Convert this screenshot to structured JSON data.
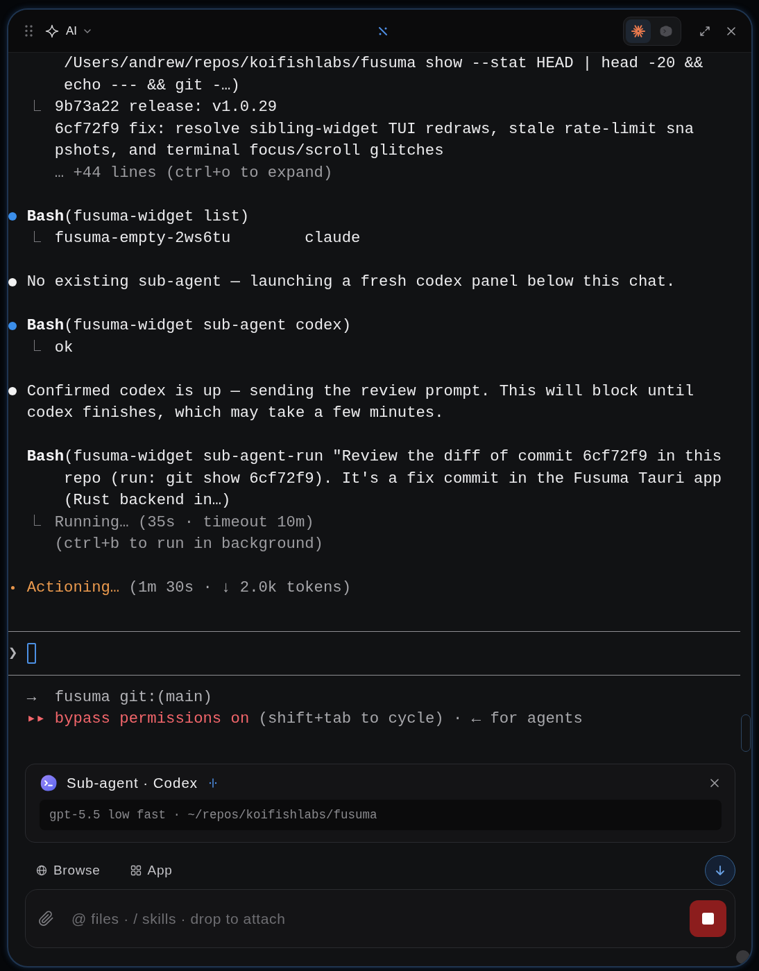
{
  "window": {
    "title": "AI",
    "agent_switch": [
      {
        "kind": "burst",
        "selected": true
      },
      {
        "kind": "blob",
        "selected": false
      }
    ]
  },
  "terminal": {
    "blocks": [
      {
        "kind": "continued",
        "lines": [
          "/Users/andrew/repos/koifishlabs/fusuma show --stat HEAD | head -20 &&",
          "echo --- && git -…)"
        ],
        "output": [
          {
            "text": "9b73a22 release: v1.0.29",
            "muted": false
          },
          {
            "text": "6cf72f9 fix: resolve sibling-widget TUI redraws, stale rate-limit sna",
            "muted": false
          },
          {
            "text": "pshots, and terminal focus/scroll glitches",
            "muted": false
          },
          {
            "text": "… +44 lines (ctrl+o to expand)",
            "muted": true
          }
        ]
      },
      {
        "kind": "tool",
        "bullet": true,
        "color": "#3b8eea",
        "name": "Bash",
        "args": [
          "(fusuma-widget list)"
        ],
        "output": [
          {
            "text": "fusuma-empty-2ws6tu        claude",
            "muted": false
          }
        ]
      },
      {
        "kind": "message",
        "bullet": true,
        "color": "#f2f2f2",
        "lines": [
          "No existing sub-agent — launching a fresh codex panel below this chat."
        ]
      },
      {
        "kind": "tool",
        "bullet": true,
        "color": "#3b8eea",
        "name": "Bash",
        "args": [
          "(fusuma-widget sub-agent codex)"
        ],
        "output": [
          {
            "text": "ok",
            "muted": false
          }
        ]
      },
      {
        "kind": "message",
        "bullet": true,
        "color": "#f2f2f2",
        "lines": [
          "Confirmed codex is up — sending the review prompt. This will block until",
          "codex finishes, which may take a few minutes."
        ]
      },
      {
        "kind": "tool",
        "bullet": false,
        "name": "Bash",
        "args": [
          "(fusuma-widget sub-agent-run \"Review the diff of commit 6cf72f9 in this",
          "repo (run: git show 6cf72f9). It's a fix commit in the Fusuma Tauri app",
          "(Rust backend in…)"
        ],
        "output": [
          {
            "text": "Running… (35s · timeout 10m)",
            "muted": true
          },
          {
            "text": "(ctrl+b to run in background)",
            "muted": true
          }
        ]
      }
    ],
    "status": {
      "label": "Actioning…",
      "detail": "(1m 30s · ↓ 2.0k tokens)"
    },
    "prompt": {
      "symbol": "❯"
    },
    "footer": [
      {
        "kind": "git",
        "text": "→  fusuma git:(main)"
      },
      {
        "kind": "mode",
        "mode": "▸▸ bypass permissions on",
        "hint": "(shift+tab to cycle) · ← for agents"
      }
    ]
  },
  "subagent": {
    "title": "Sub-agent · Codex",
    "meta": "gpt-5.5 low fast · ~/repos/koifishlabs/fusuma"
  },
  "quick_actions": [
    {
      "kind": "globe",
      "label": "Browse"
    },
    {
      "kind": "grid",
      "label": "App"
    }
  ],
  "composer": {
    "placeholder": "@ files · / skills · drop to attach"
  }
}
